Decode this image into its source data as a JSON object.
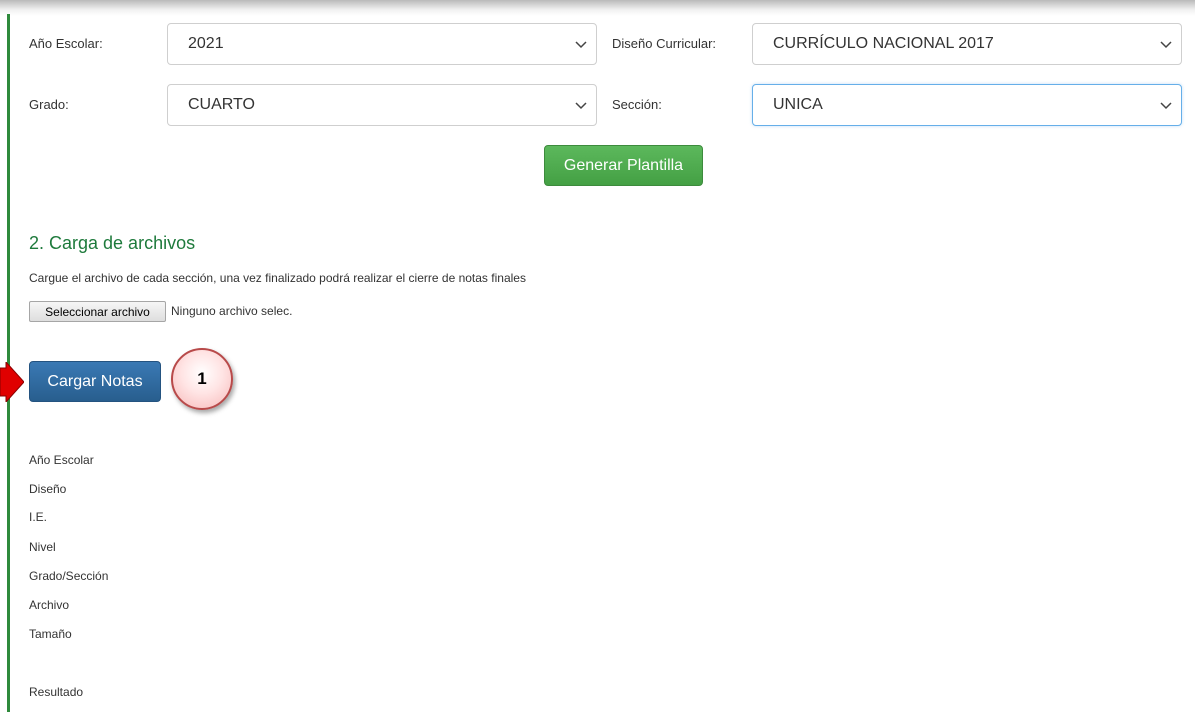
{
  "filters": {
    "anio_label": "Año Escolar:",
    "anio_value": "2021",
    "diseno_label": "Diseño Curricular:",
    "diseno_value": "CURRÍCULO NACIONAL 2017",
    "grado_label": "Grado:",
    "grado_value": "CUARTO",
    "seccion_label": "Sección:",
    "seccion_value": "UNICA"
  },
  "generar_button": "Generar Plantilla",
  "carga": {
    "title": "2. Carga de archivos",
    "description": "Cargue el archivo de cada sección, una vez finalizado podrá realizar el cierre de notas finales",
    "file_button": "Seleccionar archivo",
    "file_status": "Ninguno archivo selec.",
    "cargar_button": "Cargar Notas"
  },
  "callout_number": "1",
  "info_labels": [
    "Año Escolar",
    "Diseño",
    "I.E.",
    "Nivel",
    "Grado/Sección",
    "Archivo",
    "Tamaño",
    "Resultado"
  ],
  "colors": {
    "accent_green": "#5cb85c",
    "title_green": "#1e7a3c",
    "primary_blue": "#2f6ea5",
    "arrow_red": "#e00000"
  },
  "icons": {
    "select_arrow": "chevron-down-icon",
    "pointer": "red-arrow-icon"
  }
}
